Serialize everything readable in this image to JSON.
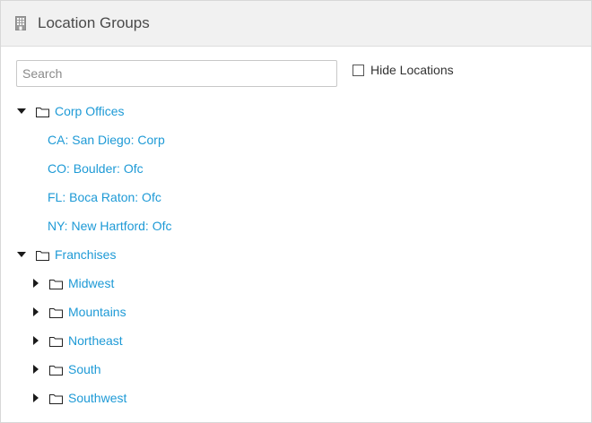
{
  "header": {
    "title": "Location Groups",
    "icon": "building-icon"
  },
  "search": {
    "placeholder": "Search",
    "value": ""
  },
  "hide_locations": {
    "label": "Hide Locations",
    "checked": false
  },
  "tree": {
    "corp": {
      "label": "Corp Offices",
      "expanded": true,
      "children": [
        "CA: San Diego: Corp",
        "CO: Boulder: Ofc",
        "FL: Boca Raton: Ofc",
        "NY: New Hartford: Ofc"
      ]
    },
    "franchises": {
      "label": "Franchises",
      "expanded": true,
      "children": [
        "Midwest",
        "Mountains",
        "Northeast",
        "South",
        "Southwest"
      ]
    }
  },
  "colors": {
    "link": "#1e9ad6",
    "header_bg": "#f1f1f1"
  }
}
